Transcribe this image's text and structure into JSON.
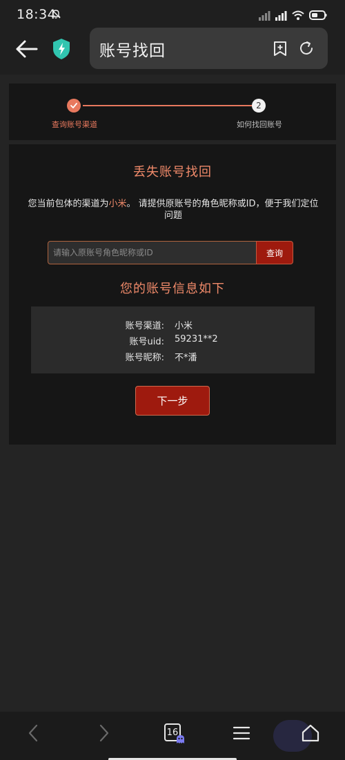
{
  "status_bar": {
    "time": "18:34",
    "battery_level": 0.6
  },
  "browser": {
    "page_title": "账号找回",
    "tabs_count": "16"
  },
  "steps": [
    {
      "label": "查询账号渠道",
      "state": "done"
    },
    {
      "number": "2",
      "label": "如何找回账号",
      "state": "pending"
    }
  ],
  "main": {
    "heading": "丢失账号找回",
    "description_prefix": "您当前包体的渠道为",
    "channel_highlight": "小米",
    "description_suffix": "。 请提供原账号的角色昵称或ID，便于我们定位问题",
    "search": {
      "placeholder": "请输入原账号角色昵称或ID",
      "value": ""
    },
    "query_button": "查询",
    "info_heading": "您的账号信息如下",
    "info_rows": [
      {
        "label": "账号渠道:",
        "value": "小米"
      },
      {
        "label": "账号uid:",
        "value": "59231**2"
      },
      {
        "label": "账号昵称:",
        "value": "不*潘"
      }
    ],
    "next_button": "下一步"
  },
  "colors": {
    "accent": "#f08a6a",
    "button": "#9e1a0e",
    "background": "#242424",
    "card": "#161616"
  },
  "icons": [
    "back-arrow-icon",
    "security-shield-icon",
    "add-bookmark-icon",
    "refresh-icon",
    "nav-back-icon",
    "nav-forward-icon",
    "tabs-icon",
    "menu-icon",
    "home-icon"
  ]
}
